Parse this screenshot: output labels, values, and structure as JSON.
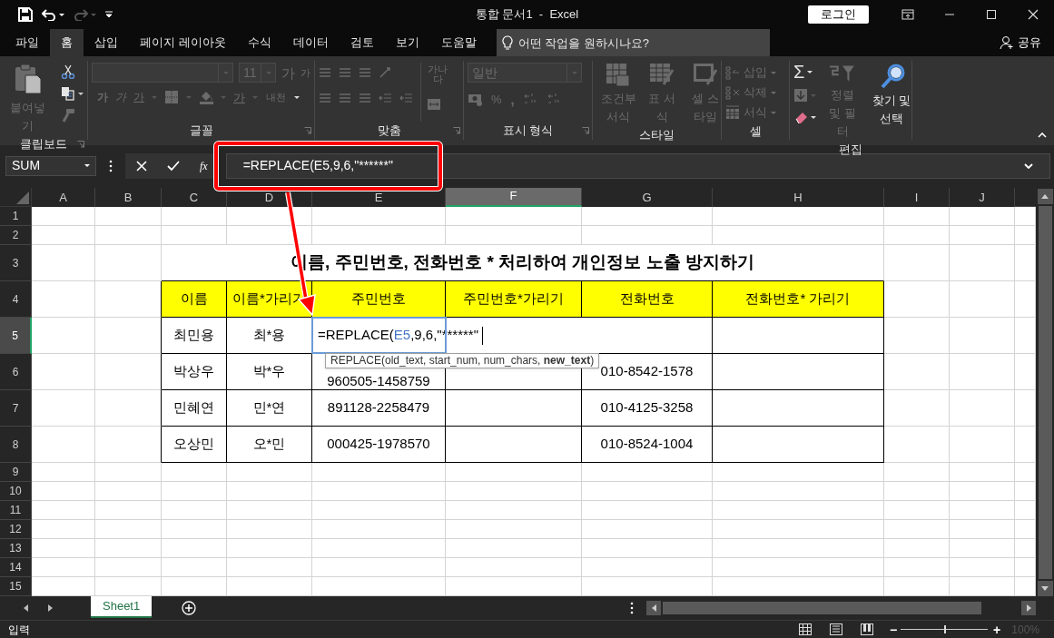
{
  "title_bar": {
    "title": "통합 문서1  -  Excel",
    "login": "로그인"
  },
  "tabs": [
    {
      "label": "파일",
      "selected": false
    },
    {
      "label": "홈",
      "selected": true
    },
    {
      "label": "삽입",
      "selected": false
    },
    {
      "label": "페이지 레이아웃",
      "selected": false
    },
    {
      "label": "수식",
      "selected": false
    },
    {
      "label": "데이터",
      "selected": false
    },
    {
      "label": "검토",
      "selected": false
    },
    {
      "label": "보기",
      "selected": false
    },
    {
      "label": "도움말",
      "selected": false
    }
  ],
  "tell_me": {
    "placeholder": "어떤 작업을 원하시나요?"
  },
  "share": "공유",
  "ribbon": {
    "groups": [
      {
        "label": "클립보드",
        "launcher": true,
        "items": [
          {
            "kind": "big",
            "label": "붙여넣기",
            "disabled": true
          },
          {
            "kind": "icon",
            "disabled": false
          },
          {
            "kind": "icon",
            "disabled": false
          },
          {
            "kind": "icon",
            "disabled": true
          }
        ]
      },
      {
        "label": "글꼴",
        "launcher": true,
        "items": [
          {
            "kind": "field",
            "disabled": true
          },
          {
            "kind": "field",
            "value": "11",
            "disabled": true
          },
          {
            "kind": "glyph",
            "text": "가",
            "disabled": true
          },
          {
            "kind": "glyph",
            "text": "가",
            "disabled": true
          },
          {
            "kind": "glyph",
            "text": "가",
            "disabled": true
          },
          {
            "kind": "glyph",
            "text": "가",
            "disabled": true
          },
          {
            "kind": "glyph",
            "text": "가",
            "disabled": true
          },
          {
            "kind": "icon",
            "disabled": true
          },
          {
            "kind": "icon",
            "disabled": true
          },
          {
            "kind": "glyph",
            "text": "가",
            "disabled": true
          },
          {
            "kind": "glyph",
            "text": "내천",
            "disabled": true
          }
        ]
      },
      {
        "label": "맞춤",
        "launcher": true,
        "items": [
          {
            "kind": "icon",
            "disabled": true
          },
          {
            "kind": "icon",
            "disabled": true
          },
          {
            "kind": "icon",
            "disabled": true
          },
          {
            "kind": "icon",
            "disabled": true
          },
          {
            "kind": "glyph",
            "text": "가나다",
            "disabled": true
          },
          {
            "kind": "icon",
            "disabled": true
          },
          {
            "kind": "icon",
            "disabled": true
          },
          {
            "kind": "icon",
            "disabled": true
          },
          {
            "kind": "icon",
            "disabled": true
          },
          {
            "kind": "icon",
            "disabled": true
          },
          {
            "kind": "icon",
            "disabled": true
          }
        ]
      },
      {
        "label": "표시 형식",
        "launcher": true,
        "items": [
          {
            "kind": "field",
            "value": "일반",
            "disabled": true
          },
          {
            "kind": "icon",
            "disabled": true
          },
          {
            "kind": "glyph",
            "text": "%",
            "disabled": true
          },
          {
            "kind": "glyph",
            "text": ",",
            "disabled": true
          },
          {
            "kind": "icon",
            "disabled": true
          },
          {
            "kind": "icon",
            "disabled": true
          }
        ]
      },
      {
        "label": "스타일",
        "launcher": false,
        "items": [
          {
            "kind": "big",
            "label": "조건부 서식",
            "disabled": true
          },
          {
            "kind": "big",
            "label": "표 서식",
            "disabled": true
          },
          {
            "kind": "big",
            "label": "셀 스타일",
            "disabled": true
          }
        ]
      },
      {
        "label": "셀",
        "launcher": false,
        "items": [
          {
            "kind": "small",
            "label": "삽입",
            "disabled": true
          },
          {
            "kind": "small",
            "label": "삭제",
            "disabled": true
          },
          {
            "kind": "small",
            "label": "서식",
            "disabled": true
          }
        ]
      },
      {
        "label": "편집",
        "launcher": false,
        "items": [
          {
            "kind": "glyph",
            "text": "Σ",
            "disabled": false
          },
          {
            "kind": "icon",
            "disabled": true
          },
          {
            "kind": "icon",
            "disabled": false
          },
          {
            "kind": "big",
            "label": "정렬 및 필터",
            "disabled": true
          },
          {
            "kind": "big",
            "label": "찾기 및 선택",
            "disabled": false
          }
        ]
      }
    ]
  },
  "formula_bar": {
    "name_box": "SUM",
    "function_button": "fx",
    "formula": "=REPLACE(E5,9,6,\"******\""
  },
  "sheet": {
    "columns": [
      {
        "label": "A",
        "selected": false
      },
      {
        "label": "B",
        "selected": false
      },
      {
        "label": "C",
        "selected": false
      },
      {
        "label": "D",
        "selected": false
      },
      {
        "label": "E",
        "selected": false
      },
      {
        "label": "F",
        "selected": true
      },
      {
        "label": "G",
        "selected": false
      },
      {
        "label": "H",
        "selected": false
      },
      {
        "label": "I",
        "selected": false
      },
      {
        "label": "J",
        "selected": false
      }
    ],
    "rows": [
      {
        "label": "1",
        "selected": false
      },
      {
        "label": "2",
        "selected": false
      },
      {
        "label": "3",
        "selected": false
      },
      {
        "label": "4",
        "selected": false
      },
      {
        "label": "5",
        "selected": true
      },
      {
        "label": "6",
        "selected": false
      },
      {
        "label": "7",
        "selected": false
      },
      {
        "label": "8",
        "selected": false
      },
      {
        "label": "9",
        "selected": false
      },
      {
        "label": "10",
        "selected": false
      },
      {
        "label": "11",
        "selected": false
      },
      {
        "label": "12",
        "selected": false
      },
      {
        "label": "13",
        "selected": false
      },
      {
        "label": "14",
        "selected": false
      },
      {
        "label": "15",
        "selected": false
      }
    ],
    "title": "이름, 주민번호, 전화번호 * 처리하여 개인정보 노출 방지하기",
    "table": {
      "header": [
        "이름",
        "이름*가리기",
        "주민번호",
        "주민번호*가리기",
        "전화번호",
        "전화번호* 가리기"
      ],
      "rows": [
        {
          "name": "최민용",
          "masked_name": "최*용",
          "editing": true,
          "edit_parts": [
            {
              "text": "=REPLACE(",
              "kind": "plain"
            },
            {
              "text": "E5",
              "kind": "ref"
            },
            {
              "text": ",9,6,\"******\"",
              "kind": "plain"
            }
          ]
        },
        {
          "name": "박상우",
          "masked_name": "박*우",
          "id_number": "960505-1458759",
          "phone": "010-8542-1578",
          "editing": false
        },
        {
          "name": "민혜연",
          "masked_name": "민*연",
          "id_number": "891128-2258479",
          "phone": "010-4125-3258",
          "editing": false
        },
        {
          "name": "오상민",
          "masked_name": "오*민",
          "id_number": "000425-1978570",
          "phone": "010-8524-1004",
          "editing": false
        }
      ]
    },
    "tooltip": "REPLACE(old_text, start_num, num_chars, **new_text**)"
  },
  "sheet_tabs": [
    {
      "label": "Sheet1",
      "selected": true
    }
  ],
  "status_bar": {
    "mode": "입력",
    "zoom_out": "−",
    "zoom_in": "+",
    "zoom": "100%",
    "zoom_level": {
      "level": 0.5
    }
  }
}
